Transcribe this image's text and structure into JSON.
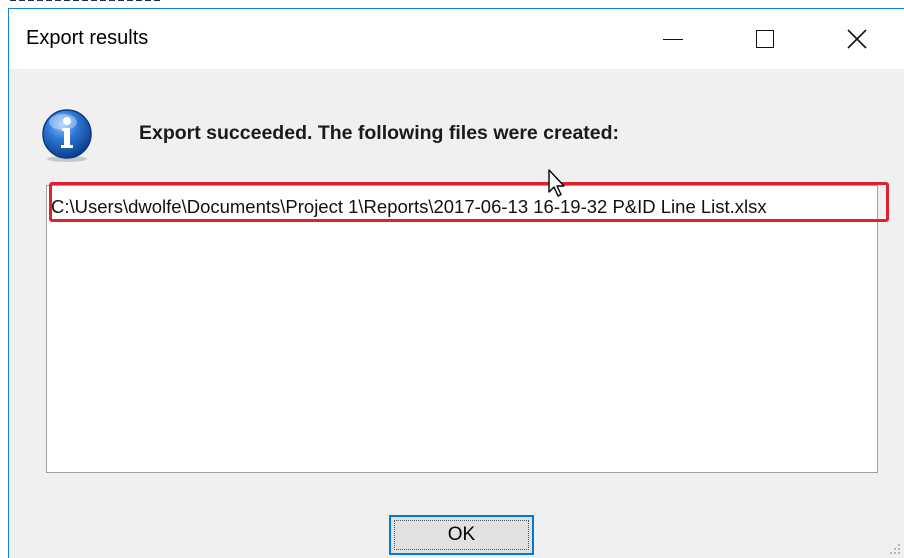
{
  "window": {
    "title": "Export results",
    "controls": {
      "minimize": "minimize-icon",
      "maximize": "maximize-icon",
      "close": "close-icon"
    }
  },
  "dialog": {
    "icon": "info-icon",
    "message": "Export succeeded. The following files were created:",
    "files": [
      "C:\\Users\\dwolfe\\Documents\\Project 1\\Reports\\2017-06-13 16-19-32 P&ID Line List.xlsx"
    ],
    "ok_label": "OK"
  },
  "colors": {
    "accent": "#0078d7",
    "highlight": "#e0202a",
    "info_blue": "#1d5fb8"
  }
}
